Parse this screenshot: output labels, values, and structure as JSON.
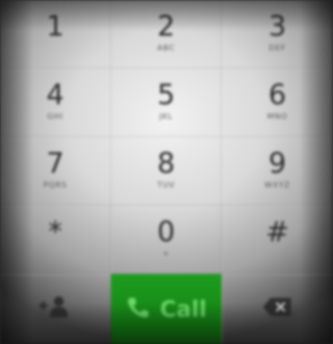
{
  "keypad": {
    "keys": [
      {
        "digit": "1",
        "letters": ""
      },
      {
        "digit": "2",
        "letters": "ABC"
      },
      {
        "digit": "3",
        "letters": "DEF"
      },
      {
        "digit": "4",
        "letters": "GHI"
      },
      {
        "digit": "5",
        "letters": "JKL"
      },
      {
        "digit": "6",
        "letters": "MNO"
      },
      {
        "digit": "7",
        "letters": "PQRS"
      },
      {
        "digit": "8",
        "letters": "TUV"
      },
      {
        "digit": "9",
        "letters": "WXYZ"
      },
      {
        "digit": "*",
        "letters": ""
      },
      {
        "digit": "0",
        "letters": "+"
      },
      {
        "digit": "#",
        "letters": ""
      }
    ],
    "call_label": "Call",
    "add_contact_icon": "add-contact-icon",
    "phone_icon": "phone-icon",
    "backspace_icon": "backspace-icon"
  },
  "colors": {
    "call_green": "#169016",
    "call_text": "#6bd96b",
    "key_text": "#2c2c2c"
  }
}
